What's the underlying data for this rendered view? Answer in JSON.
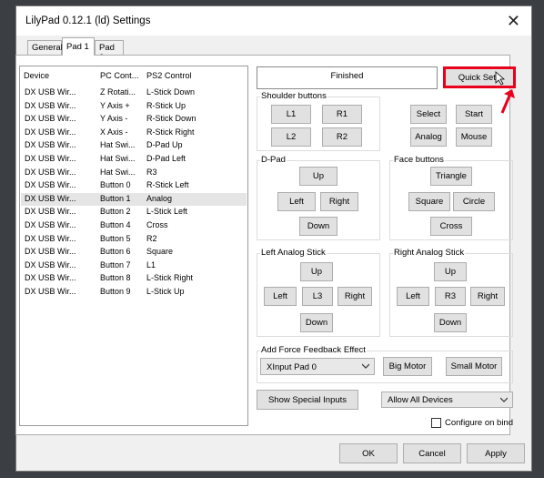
{
  "window": {
    "title": "LilyPad 0.12.1 (ld) Settings"
  },
  "tabs": [
    {
      "label": "General"
    },
    {
      "label": "Pad 1",
      "active": true
    },
    {
      "label": "Pad 2"
    }
  ],
  "list": {
    "headers": [
      "Device",
      "PC Cont...",
      "PS2 Control"
    ],
    "rows": [
      [
        "DX USB Wir...",
        "Z Rotati...",
        "L-Stick Down"
      ],
      [
        "DX USB Wir...",
        "Y Axis +",
        "R-Stick Up"
      ],
      [
        "DX USB Wir...",
        "Y Axis -",
        "R-Stick Down"
      ],
      [
        "DX USB Wir...",
        "X Axis -",
        "R-Stick Right"
      ],
      [
        "DX USB Wir...",
        "Hat Swi...",
        "D-Pad Up"
      ],
      [
        "DX USB Wir...",
        "Hat Swi...",
        "D-Pad Left"
      ],
      [
        "DX USB Wir...",
        "Hat Swi...",
        "R3"
      ],
      [
        "DX USB Wir...",
        "Button 0",
        "R-Stick Left"
      ],
      [
        "DX USB Wir...",
        "Button 1",
        "Analog"
      ],
      [
        "DX USB Wir...",
        "Button 2",
        "L-Stick Left"
      ],
      [
        "DX USB Wir...",
        "Button 4",
        "Cross"
      ],
      [
        "DX USB Wir...",
        "Button 5",
        "R2"
      ],
      [
        "DX USB Wir...",
        "Button 6",
        "Square"
      ],
      [
        "DX USB Wir...",
        "Button 7",
        "L1"
      ],
      [
        "DX USB Wir...",
        "Button 8",
        "L-Stick Right"
      ],
      [
        "DX USB Wir...",
        "Button 9",
        "L-Stick Up"
      ]
    ],
    "selected_row": 8
  },
  "status_text": "Finished",
  "quick_setup_label": "Quick Setu",
  "shoulder": {
    "label": "Shoulder buttons",
    "l1": "L1",
    "r1": "R1",
    "l2": "L2",
    "r2": "R2"
  },
  "system": {
    "select": "Select",
    "start": "Start",
    "analog": "Analog",
    "mouse": "Mouse"
  },
  "dpad": {
    "label": "D-Pad",
    "up": "Up",
    "left": "Left",
    "right": "Right",
    "down": "Down"
  },
  "face": {
    "label": "Face buttons",
    "triangle": "Triangle",
    "square": "Square",
    "circle": "Circle",
    "cross": "Cross"
  },
  "left_stick": {
    "label": "Left Analog Stick",
    "up": "Up",
    "left": "Left",
    "press": "L3",
    "right": "Right",
    "down": "Down"
  },
  "right_stick": {
    "label": "Right Analog Stick",
    "up": "Up",
    "left": "Left",
    "press": "R3",
    "right": "Right",
    "down": "Down"
  },
  "force_feedback": {
    "label": "Add Force Feedback Effect",
    "device": "XInput Pad 0",
    "big_motor": "Big Motor",
    "small_motor": "Small Motor"
  },
  "show_special_inputs": "Show Special Inputs",
  "device_filter": "Allow All Devices",
  "configure_on_bind": {
    "label": "Configure on bind",
    "checked": false
  },
  "footer": {
    "ok": "OK",
    "cancel": "Cancel",
    "apply": "Apply"
  },
  "colors": {
    "highlight": "#e8001c",
    "window_bg": "#f0f0f0",
    "panel_bg": "#ffffff",
    "button_bg": "#e1e1e1",
    "desktop_bg": "#3b3e42"
  }
}
